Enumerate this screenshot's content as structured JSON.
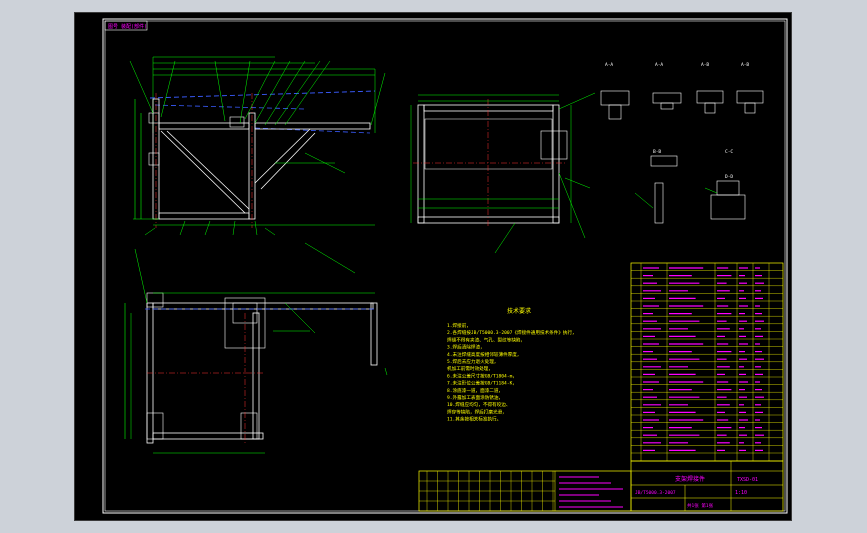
{
  "title_block_tag": "图号 装配(部件)",
  "section_labels": [
    "A-A",
    "A-A",
    "A-B",
    "A-B",
    "B-B",
    "C-C",
    "D-D"
  ],
  "tech_requirements": {
    "heading": "技术要求",
    "items": [
      "1.焊接前，",
      "2.各焊缝按JB/T5000.3-2007《焊接件通用技术条件》执行，",
      "  焊缝不得有夹渣、气孔、裂纹等缺陷，",
      "3.焊后清除焊渣，",
      "4.未注焊缝高度按相邻较薄件厚度，",
      "5.焊后去应力退火处理，",
      "  机加工前需时效处理，",
      "6.未注公差尺寸按GB/T1804-m，",
      "7.未注形位公差按GB/T1184-K，",
      "8.涂底漆一道，面漆二道，",
      "9.外露加工表面涂防锈油，",
      "10.焊缝应均匀，不得有咬边、",
      "  焊穿等缺陷，焊后打磨光滑，",
      "11.其余按相关标准执行。"
    ]
  },
  "drawing_info": {
    "name": "支架焊接件",
    "drawing_no": "TXSD-01",
    "scale": "1:10",
    "sheet": "共1张 第1张",
    "standard": "JB/T5000.3-2007"
  },
  "colors": {
    "sheet_bg": "#000000",
    "frame": "#ffffff",
    "part_lines": "#ffffff",
    "dims": "#00ff00",
    "center": "#ff3333",
    "hidden": "#3a5cff",
    "leaders": "#ffff00",
    "table": "#ffff00",
    "table_text": "#ff00ff"
  }
}
